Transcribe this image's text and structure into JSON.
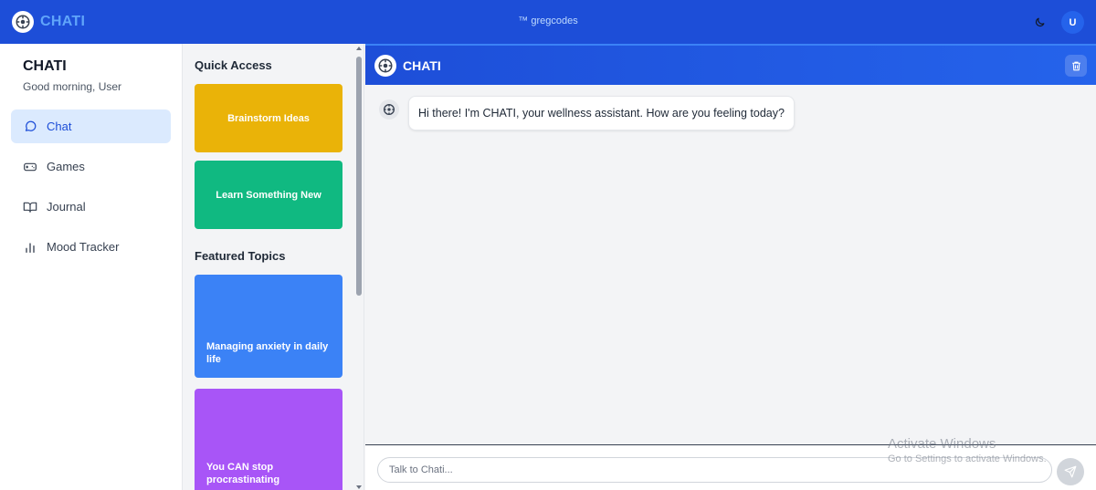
{
  "topbar": {
    "app_name": "CHATI",
    "center_text": "™ gregcodes",
    "theme_icon": "moon-icon",
    "avatar_initial": "U"
  },
  "sidebar": {
    "title": "CHATI",
    "greeting": "Good morning, User",
    "items": [
      {
        "label": "Chat",
        "icon": "chat-bubble-icon",
        "active": true
      },
      {
        "label": "Games",
        "icon": "gamepad-icon",
        "active": false
      },
      {
        "label": "Journal",
        "icon": "book-icon",
        "active": false
      },
      {
        "label": "Mood Tracker",
        "icon": "bar-chart-icon",
        "active": false
      }
    ]
  },
  "panel": {
    "quick_access_title": "Quick Access",
    "quick_access": [
      {
        "label": "Brainstorm Ideas",
        "color": "#eab308"
      },
      {
        "label": "Learn Something New",
        "color": "#10b981"
      }
    ],
    "featured_title": "Featured Topics",
    "featured": [
      {
        "label": "Managing anxiety in daily life",
        "color": "#3b82f6"
      },
      {
        "label": "You CAN stop procrastinating",
        "color": "#a855f7"
      }
    ]
  },
  "chat": {
    "title": "CHATI",
    "messages": [
      {
        "sender": "bot",
        "text": "Hi there! I'm CHATI, your wellness assistant. How are you feeling today?"
      }
    ],
    "input_placeholder": "Talk to Chati...",
    "input_value": ""
  },
  "watermark": {
    "title": "Activate Windows",
    "subtitle": "Go to Settings to activate Windows."
  },
  "colors": {
    "topbar": "#1d4ed8",
    "accent": "#2563eb",
    "active_nav_bg": "#dbeafe"
  }
}
